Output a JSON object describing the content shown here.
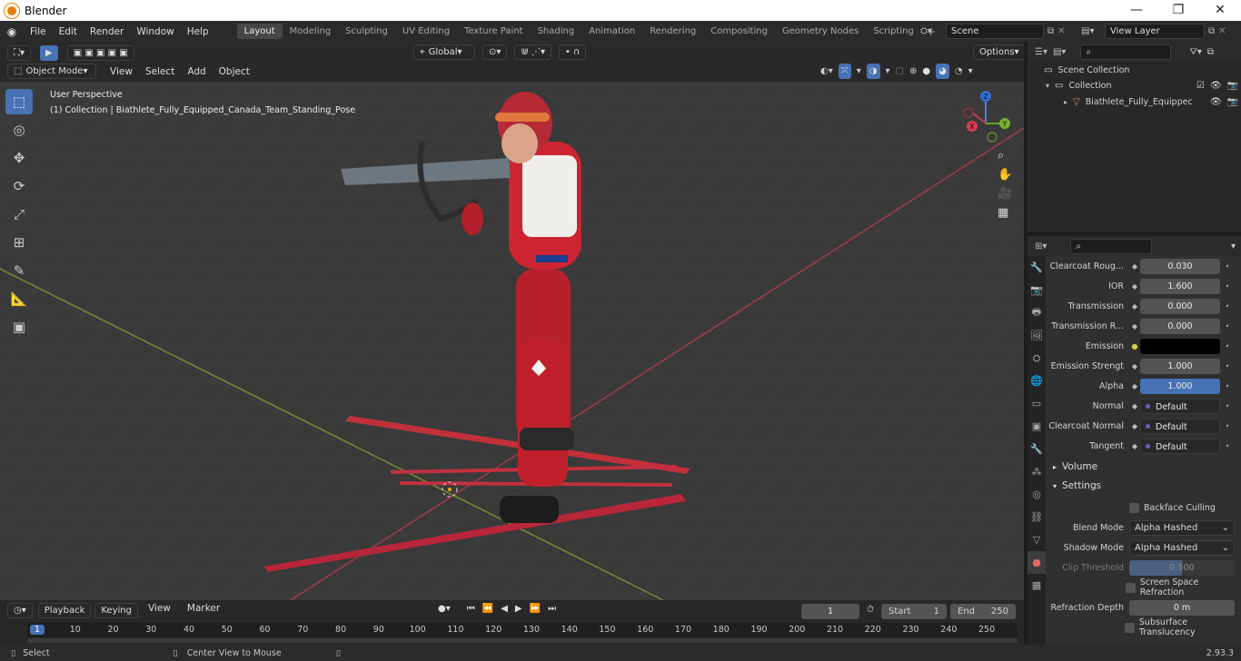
{
  "window": {
    "title": "Blender"
  },
  "menus": [
    "File",
    "Edit",
    "Render",
    "Window",
    "Help"
  ],
  "workspaces": [
    {
      "label": "Layout",
      "active": true
    },
    {
      "label": "Modeling"
    },
    {
      "label": "Sculpting"
    },
    {
      "label": "UV Editing"
    },
    {
      "label": "Texture Paint"
    },
    {
      "label": "Shading"
    },
    {
      "label": "Animation"
    },
    {
      "label": "Rendering"
    },
    {
      "label": "Compositing"
    },
    {
      "label": "Geometry Nodes"
    },
    {
      "label": "Scripting"
    }
  ],
  "scene": {
    "name": "Scene",
    "view_layer": "View Layer"
  },
  "viewport": {
    "mode": "Object Mode",
    "menus": [
      "View",
      "Select",
      "Add",
      "Object"
    ],
    "transform_orientation": "Global",
    "options_label": "Options",
    "overlay_line1": "User Perspective",
    "overlay_line2": "(1) Collection | Biathlete_Fully_Equipped_Canada_Team_Standing_Pose",
    "gizmo_axes": [
      "Z",
      "Y",
      "X"
    ]
  },
  "outliner": {
    "root": "Scene Collection",
    "collection": "Collection",
    "object": "Biathlete_Fully_Equippec"
  },
  "properties": {
    "rows": [
      {
        "label": "Clearcoat Roug...",
        "value": "0.030"
      },
      {
        "label": "IOR",
        "value": "1.600"
      },
      {
        "label": "Transmission",
        "value": "0.000"
      },
      {
        "label": "Transmission R...",
        "value": "0.000"
      },
      {
        "label": "Emission",
        "value": ""
      },
      {
        "label": "Emission Strengt",
        "value": "1.000"
      },
      {
        "label": "Alpha",
        "value": "1.000"
      },
      {
        "label": "Normal",
        "value": "Default"
      },
      {
        "label": "Clearcoat Normal",
        "value": "Default"
      },
      {
        "label": "Tangent",
        "value": "Default"
      }
    ],
    "panel_volume": "Volume",
    "panel_settings": "Settings",
    "backface_culling": "Backface Culling",
    "blend_mode_label": "Blend Mode",
    "blend_mode_value": "Alpha Hashed",
    "shadow_mode_label": "Shadow Mode",
    "shadow_mode_value": "Alpha Hashed",
    "clip_threshold_label": "Clip Threshold",
    "clip_threshold_value": "0.500",
    "screen_space_refraction": "Screen Space Refraction",
    "refraction_depth_label": "Refraction Depth",
    "refraction_depth_value": "0 m",
    "subsurface_translucency": "Subsurface Translucency"
  },
  "timeline": {
    "menus": [
      "Playback",
      "Keying",
      "View",
      "Marker"
    ],
    "current_frame": "1",
    "start_label": "Start",
    "start_value": "1",
    "end_label": "End",
    "end_value": "250",
    "ticks": [
      "1",
      "10",
      "20",
      "30",
      "40",
      "50",
      "60",
      "70",
      "80",
      "90",
      "100",
      "110",
      "120",
      "130",
      "140",
      "150",
      "160",
      "170",
      "180",
      "190",
      "200",
      "210",
      "220",
      "230",
      "240",
      "250"
    ]
  },
  "statusbar": {
    "select": "Select",
    "center_view": "Center View to Mouse",
    "version": "2.93.3"
  }
}
